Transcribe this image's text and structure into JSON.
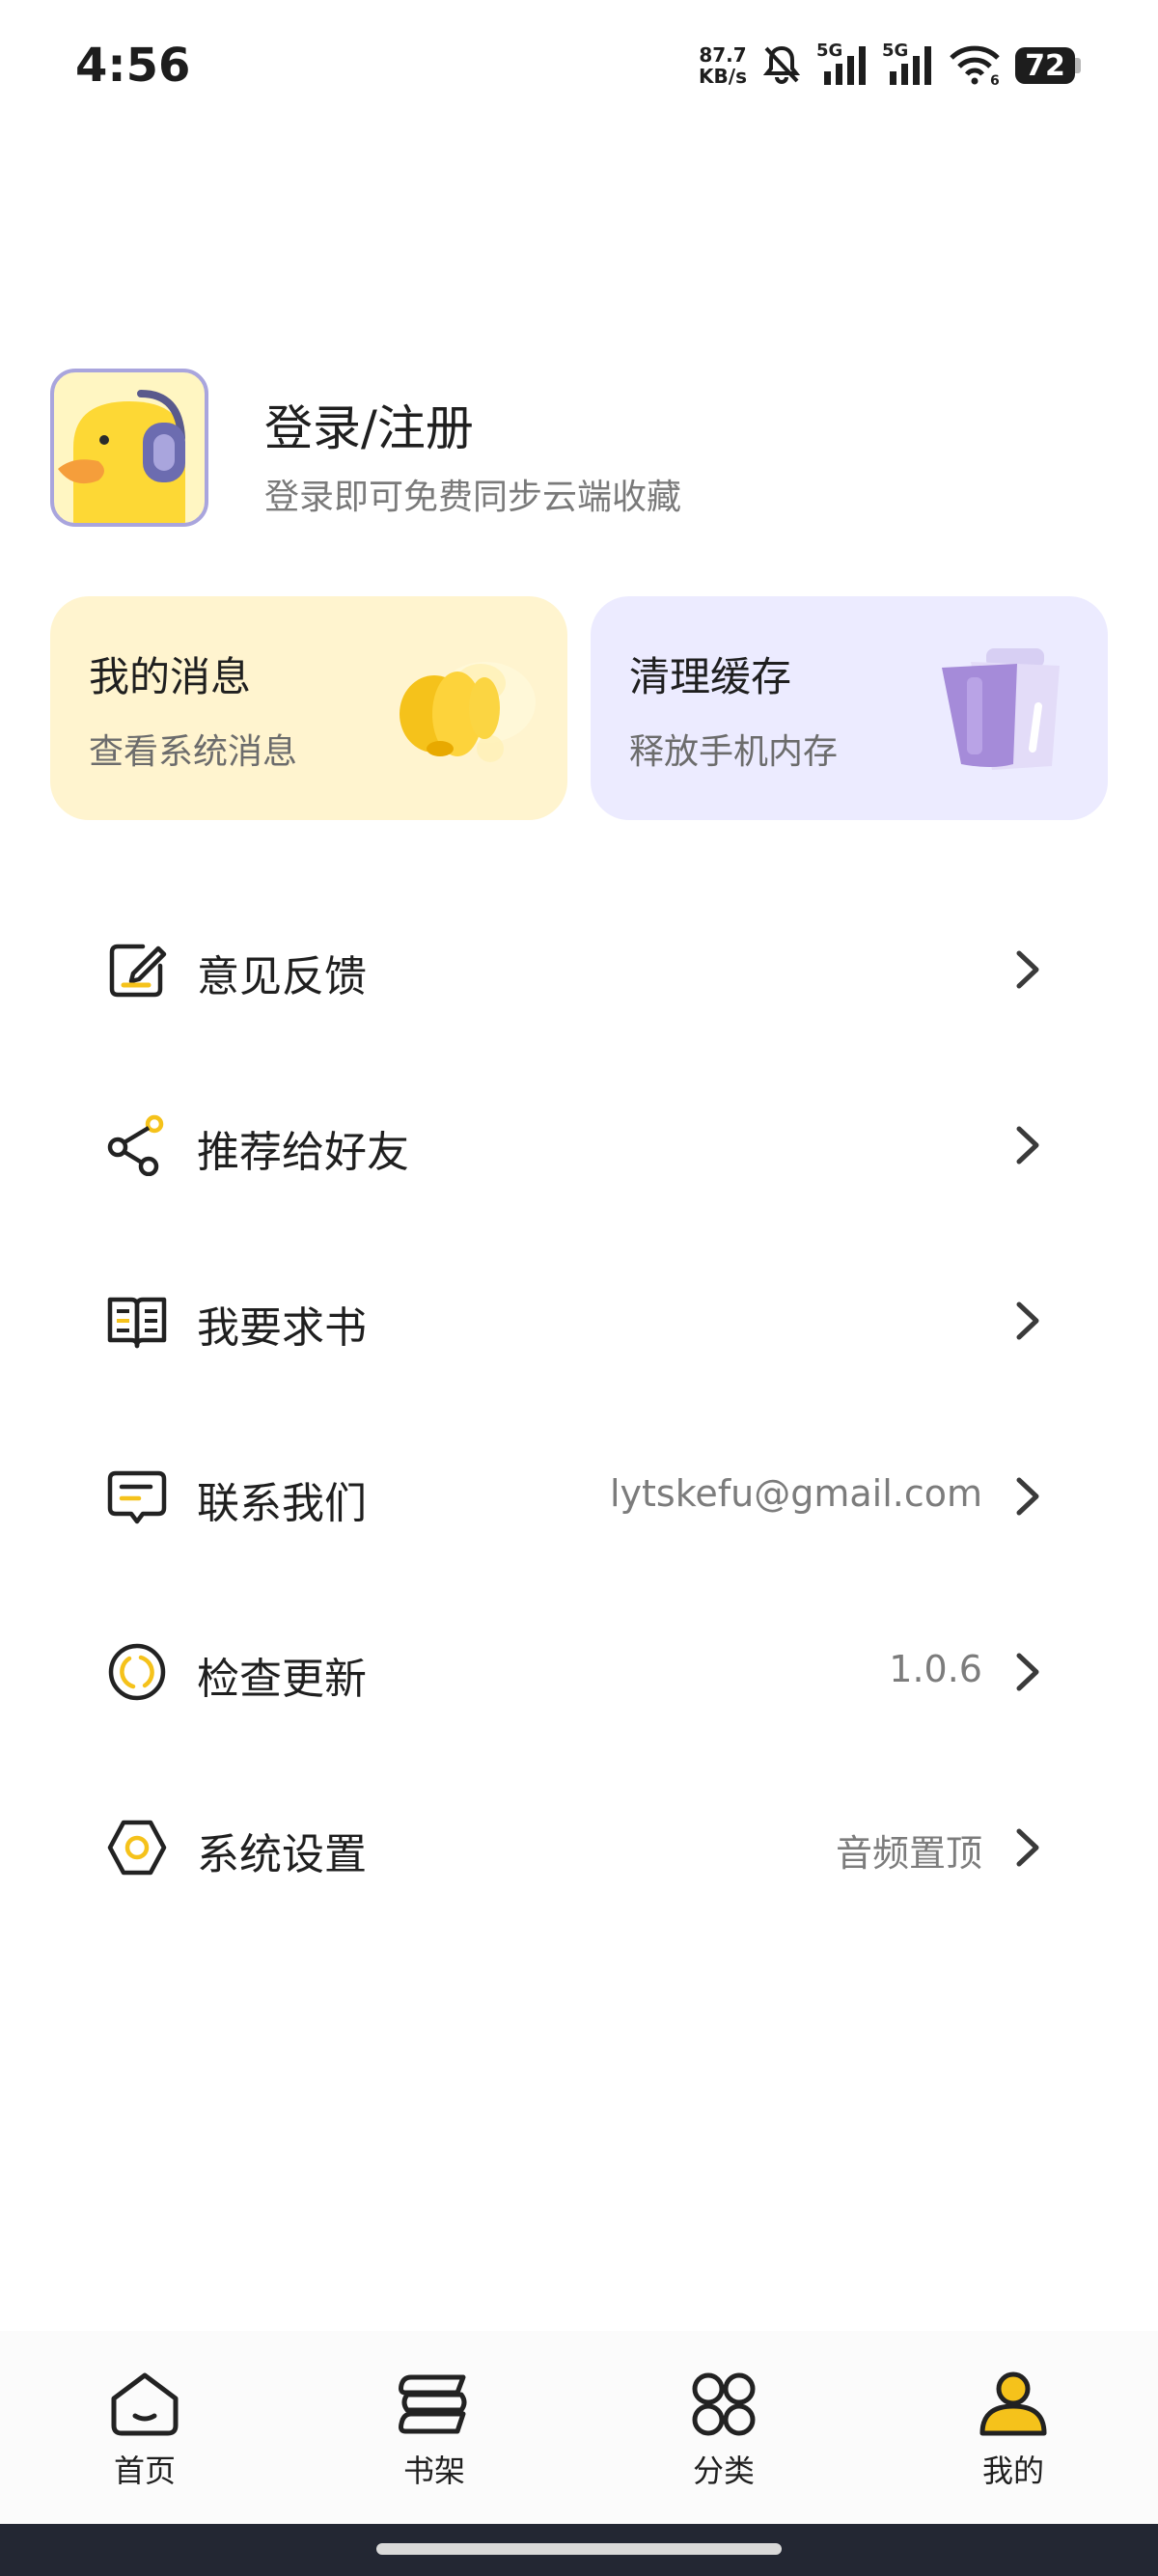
{
  "status_bar": {
    "time": "4:56",
    "net_speed_value": "87.7",
    "net_speed_unit": "KB/s",
    "sim1": "5G",
    "sim2": "5G",
    "wifi_sub": "6",
    "battery": "72"
  },
  "profile": {
    "title": "登录/注册",
    "subtitle": "登录即可免费同步云端收藏",
    "avatar_icon": "duck-headphones-icon"
  },
  "cards": [
    {
      "title": "我的消息",
      "subtitle": "查看系统消息",
      "icon": "bell-icon",
      "bg": "#fff4cf"
    },
    {
      "title": "清理缓存",
      "subtitle": "释放手机内存",
      "icon": "trash-icon",
      "bg": "#ecebff"
    }
  ],
  "menu": [
    {
      "label": "意见反馈",
      "value": "",
      "icon": "edit-icon"
    },
    {
      "label": "推荐给好友",
      "value": "",
      "icon": "share-icon"
    },
    {
      "label": "我要求书",
      "value": "",
      "icon": "book-icon"
    },
    {
      "label": "联系我们",
      "value": "lytskefu@gmail.com",
      "icon": "message-icon"
    },
    {
      "label": "检查更新",
      "value": "1.0.6",
      "icon": "refresh-icon"
    },
    {
      "label": "系统设置",
      "value": "音频置顶",
      "icon": "settings-icon"
    }
  ],
  "nav": [
    {
      "label": "首页",
      "icon": "home-icon"
    },
    {
      "label": "书架",
      "icon": "bookshelf-icon"
    },
    {
      "label": "分类",
      "icon": "category-icon"
    },
    {
      "label": "我的",
      "icon": "profile-icon",
      "active": true
    }
  ],
  "colors": {
    "accent_yellow": "#f5c21b",
    "accent_purple": "#a58bd9",
    "text_primary": "#1f1f1f",
    "text_secondary": "#7a7a7a"
  }
}
